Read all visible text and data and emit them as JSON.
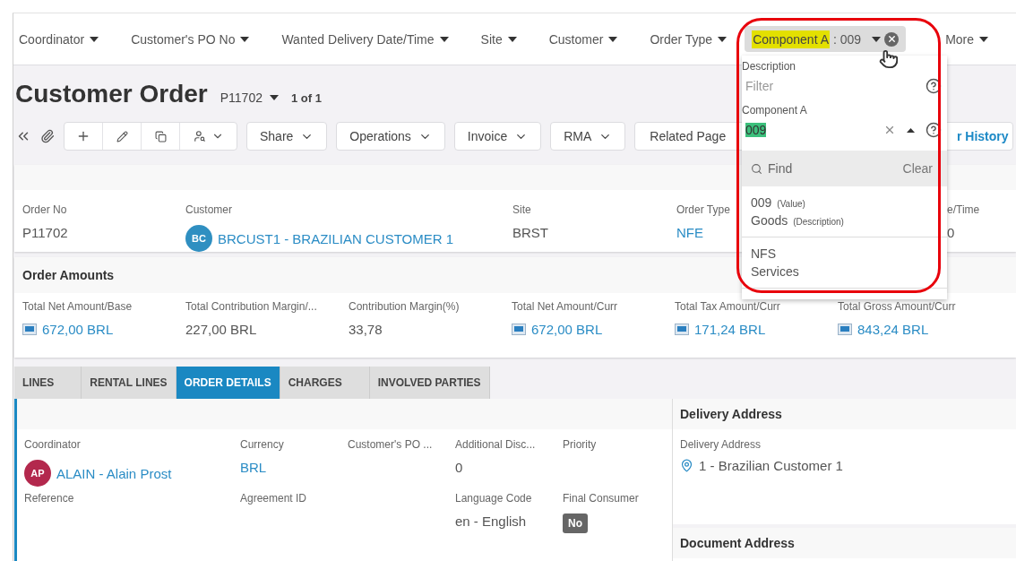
{
  "filter_bar": {
    "filters": [
      {
        "label": "Coordinator"
      },
      {
        "label": "Customer's PO No"
      },
      {
        "label": "Wanted Delivery Date/Time"
      },
      {
        "label": "Site"
      },
      {
        "label": "Customer"
      },
      {
        "label": "Order Type"
      }
    ],
    "active_filter": {
      "label": "Component A",
      "value": ": 009"
    },
    "more": "More"
  },
  "dropdown": {
    "description_label": "Description",
    "filter_placeholder": "Filter",
    "component_label": "Component A",
    "component_value": "009",
    "find_placeholder": "Find",
    "clear": "Clear",
    "options": [
      {
        "value": "009",
        "value_tag": "(Value)",
        "description": "Goods",
        "description_tag": "(Description)"
      },
      {
        "value": "NFS",
        "description": "Services"
      }
    ]
  },
  "page": {
    "title": "Customer Order",
    "record": "P11702",
    "record_count": "1 of 1"
  },
  "toolbar": {
    "menus": [
      {
        "label": "Share"
      },
      {
        "label": "Operations"
      },
      {
        "label": "Invoice"
      },
      {
        "label": "RMA"
      }
    ],
    "related": "Related Page",
    "history": "r History"
  },
  "header": {
    "fields": [
      {
        "label": "Order No",
        "value": "P11702",
        "kind": "text"
      },
      {
        "label": "Customer",
        "value": "BRCUST1 - BRAZILIAN CUSTOMER 1",
        "kind": "avatar-link",
        "initials": "BC",
        "color": "#2f8fc1"
      },
      {
        "label": "Site",
        "value": "BRST",
        "kind": "text"
      },
      {
        "label": "Order Type",
        "value": "NFE",
        "kind": "link"
      },
      {
        "label": "e/Time",
        "value": "0",
        "kind": "text"
      }
    ]
  },
  "amounts": {
    "title": "Order Amounts",
    "fields": [
      {
        "label": "Total Net Amount/Base",
        "value": "672,00 BRL",
        "kind": "amount"
      },
      {
        "label": "Total Contribution Margin/...",
        "value": "227,00 BRL",
        "kind": "text"
      },
      {
        "label": "Contribution Margin(%)",
        "value": "33,78",
        "kind": "text"
      },
      {
        "label": "Total Net Amount/Curr",
        "value": "672,00 BRL",
        "kind": "amount"
      },
      {
        "label": "Total Tax Amount/Curr",
        "value": "171,24 BRL",
        "kind": "amount"
      },
      {
        "label": "Total Gross Amount/Curr",
        "value": "843,24 BRL",
        "kind": "amount"
      }
    ]
  },
  "tabs": [
    {
      "label": "LINES",
      "selected": false
    },
    {
      "label": "RENTAL LINES",
      "selected": false
    },
    {
      "label": "ORDER DETAILS",
      "selected": true
    },
    {
      "label": "CHARGES",
      "selected": false
    },
    {
      "label": "INVOLVED PARTIES",
      "selected": false
    }
  ],
  "details": {
    "fields": [
      {
        "label": "Coordinator",
        "value": "ALAIN - Alain Prost",
        "kind": "avatar-link",
        "initials": "AP",
        "color": "#b3284d"
      },
      {
        "label": "Currency",
        "value": "BRL",
        "kind": "link"
      },
      {
        "label": "Customer's PO ...",
        "kind": "text"
      },
      {
        "label": "Additional Disc...",
        "value": "0",
        "kind": "text"
      },
      {
        "label": "Priority",
        "kind": "text"
      },
      {
        "label": "Reference",
        "kind": "text"
      },
      {
        "label": "Agreement ID",
        "kind": "text"
      },
      {
        "kind": "empty"
      },
      {
        "label": "Language Code",
        "value": "en - English",
        "kind": "text"
      },
      {
        "label": "Final Consumer",
        "value": "No",
        "kind": "badge"
      }
    ]
  },
  "delivery_address": {
    "title": "Delivery Address",
    "label": "Delivery Address",
    "value": "1 - Brazilian Customer 1"
  },
  "document_address": {
    "title": "Document Address"
  }
}
